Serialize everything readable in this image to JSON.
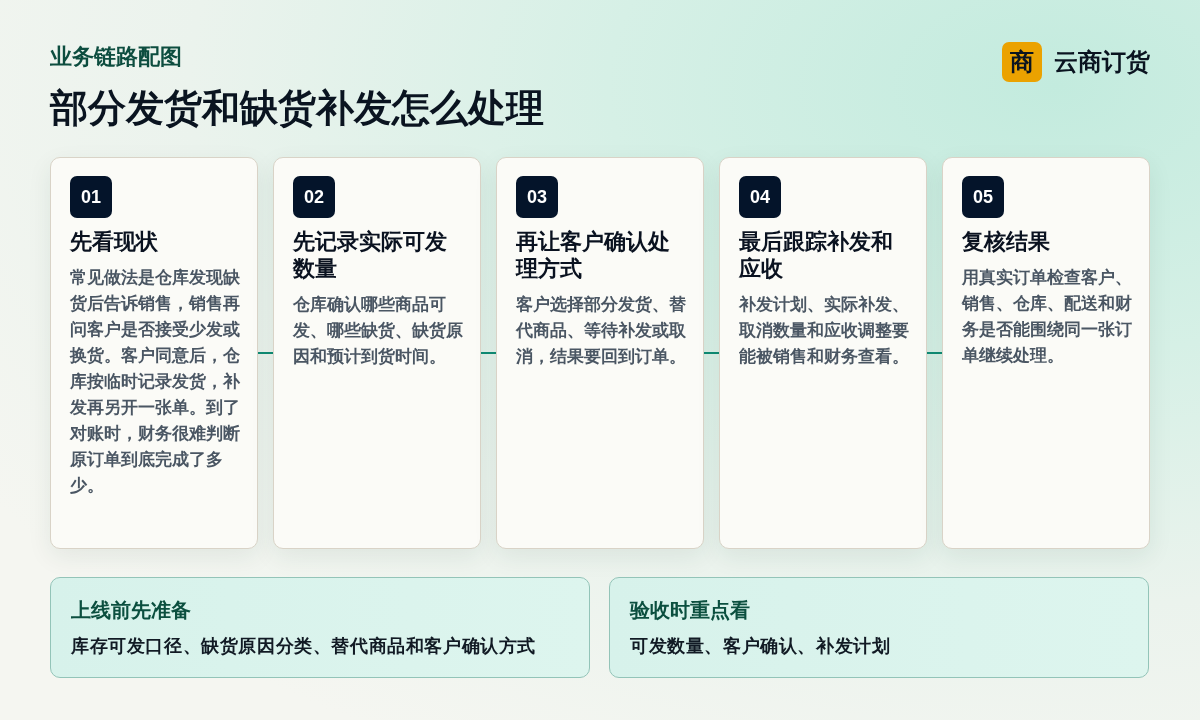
{
  "header": {
    "eyebrow": "业务链路配图",
    "title": "部分发货和缺货补发怎么处理"
  },
  "brand": {
    "logo_text": "商",
    "name": "云商订货"
  },
  "steps": [
    {
      "number": "01",
      "title": "先看现状",
      "body": "常见做法是仓库发现缺货后告诉销售，销售再问客户是否接受少发或换货。客户同意后，仓库按临时记录发货，补发再另开一张单。到了对账时，财务很难判断原订单到底完成了多少。"
    },
    {
      "number": "02",
      "title": "先记录实际可发数量",
      "body": "仓库确认哪些商品可发、哪些缺货、缺货原因和预计到货时间。"
    },
    {
      "number": "03",
      "title": "再让客户确认处理方式",
      "body": "客户选择部分发货、替代商品、等待补发或取消，结果要回到订单。"
    },
    {
      "number": "04",
      "title": "最后跟踪补发和应收",
      "body": "补发计划、实际补发、取消数量和应收调整要能被销售和财务查看。"
    },
    {
      "number": "05",
      "title": "复核结果",
      "body": "用真实订单检查客户、销售、仓库、配送和财务是否能围绕同一张订单继续处理。"
    }
  ],
  "notes": [
    {
      "title": "上线前先准备",
      "body": "库存可发口径、缺货原因分类、替代商品和客户确认方式"
    },
    {
      "title": "验收时重点看",
      "body": "可发数量、客户确认、补发计划"
    }
  ]
}
